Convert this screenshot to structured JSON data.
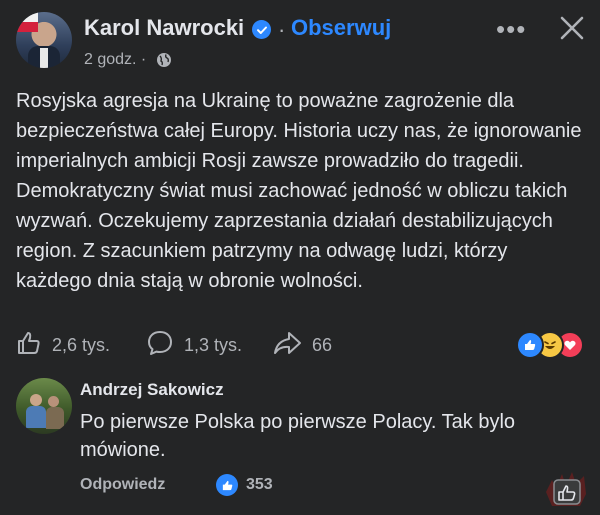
{
  "post": {
    "author": "Karol Nawrocki",
    "follow_label": "Obserwuj",
    "separator": "·",
    "time": "2 godz. ·",
    "text": "Rosyjska agresja na Ukrainę to poważne zagrożenie dla bezpieczeństwa całej Europy. Historia uczy nas, że ignorowanie imperialnych ambicji Rosji zawsze prowadziło do tragedii. Demokratyczny świat musi zachować jedność w obliczu takich wyzwań. Oczekujemy zaprzestania działań destabilizujących region. Z szacunkiem patrzymy na odwagę ludzi, którzy każdego dnia stają w obronie wolności.",
    "more_label": "•••",
    "likes": "2,6 tys.",
    "comments": "1,3 tys.",
    "shares": "66"
  },
  "comment": {
    "author": "Andrzej Sakowicz",
    "text": "Po pierwsze Polska po pierwsze Polacy.  Tak bylo mówione.",
    "reply_label": "Odpowiedz",
    "likes": "353"
  },
  "colors": {
    "background": "#242526",
    "text": "#e4e6eb",
    "muted": "#b0b3b8",
    "accent": "#2d88ff"
  },
  "icons": [
    "verified-badge-icon",
    "more-options-icon",
    "close-icon",
    "globe-icon",
    "like-icon",
    "comment-icon",
    "share-icon",
    "like-reaction-icon",
    "haha-reaction-icon",
    "love-reaction-icon"
  ]
}
